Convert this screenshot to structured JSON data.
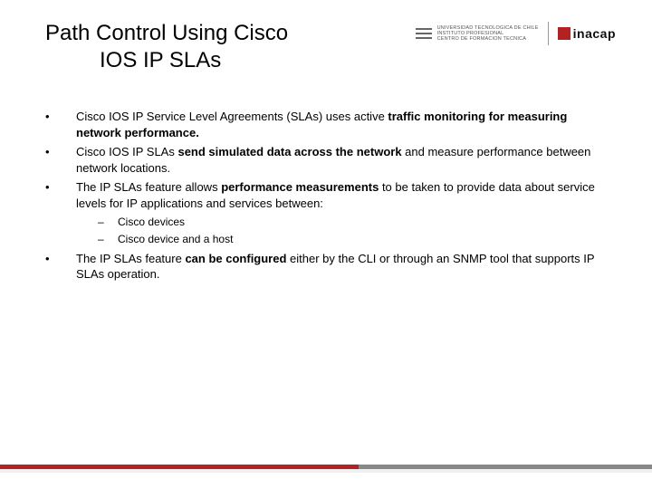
{
  "title_line1": "Path Control Using Cisco",
  "title_line2": "IOS IP SLAs",
  "logo": {
    "utc_line1": "UNIVERSIDAD TECNOLOGICA DE CHILE",
    "utc_line2": "INSTITUTO PROFESIONAL",
    "utc_line3": "CENTRO DE FORMACION TECNICA",
    "inacap": "inacap"
  },
  "bullets": [
    {
      "pre": "Cisco IOS IP Service Level Agreements (SLAs) uses active ",
      "bold": "traffic monitoring for measuring network performance.",
      "post": ""
    },
    {
      "pre": "Cisco IOS IP SLAs ",
      "bold": "send simulated data across the network",
      "post": " and measure performance between network locations."
    },
    {
      "pre": "The IP SLAs feature allows ",
      "bold": "performance measurements",
      "post": " to be taken to provide data about service levels for IP applications and services between:"
    }
  ],
  "sub_bullets": [
    "Cisco devices",
    "Cisco device and a host"
  ],
  "bullet4": {
    "pre": "The IP SLAs feature ",
    "bold": "can be configured",
    "post": " either by the CLI or through an SNMP tool that supports IP SLAs operation."
  }
}
